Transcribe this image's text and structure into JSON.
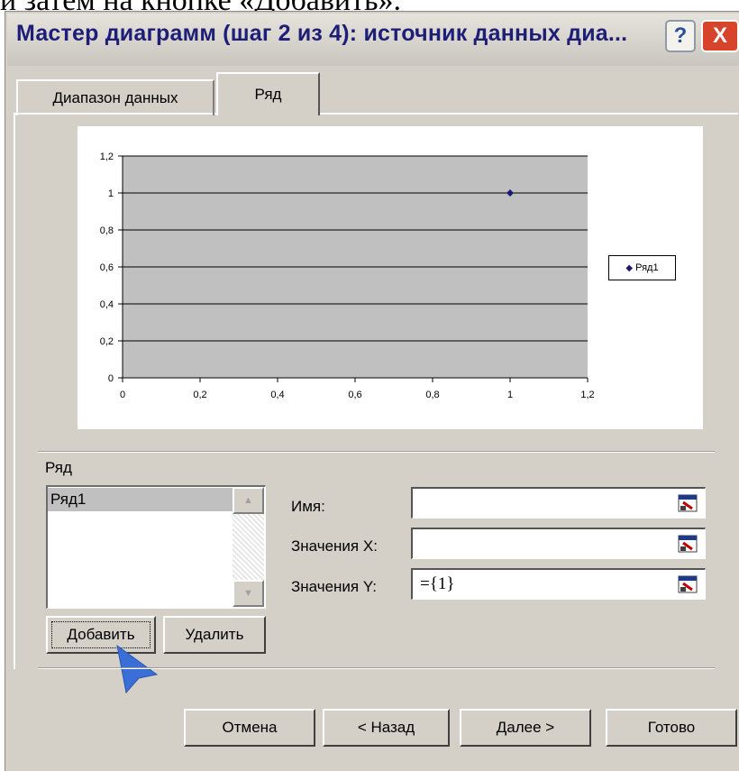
{
  "top_caption": "и затем на кнопке «Добавить».",
  "dialog": {
    "title": "Мастер диаграмм (шаг 2 из 4): источник данных диа...",
    "help_label": "?",
    "close_label": "X"
  },
  "tabs": [
    {
      "label": "Диапазон данных",
      "active": false
    },
    {
      "label": "Ряд",
      "active": true
    }
  ],
  "chart_data": {
    "type": "scatter",
    "series": [
      {
        "name": "Ряд1",
        "x": [
          1
        ],
        "y": [
          1
        ]
      }
    ],
    "xlim": [
      0,
      1.2
    ],
    "ylim": [
      0,
      1.2
    ],
    "x_ticks": [
      "0",
      "0,2",
      "0,4",
      "0,6",
      "0,8",
      "1",
      "1,2"
    ],
    "y_ticks": [
      "0",
      "0,2",
      "0,4",
      "0,6",
      "0,8",
      "1",
      "1,2"
    ],
    "grid": "horizontal",
    "legend": "right",
    "legend_label": "Ряд1",
    "plot_bg": "#c0c0c0",
    "marker_color": "#1a1a6e"
  },
  "series_section": {
    "label": "Ряд",
    "items": [
      "Ряд1"
    ],
    "selected": "Ряд1",
    "add_label": "Добавить",
    "remove_label": "Удалить"
  },
  "fields": {
    "name_label": "Имя:",
    "name_value": "",
    "x_label": "Значения X:",
    "x_value": "",
    "y_label": "Значения Y:",
    "y_value": "={1}"
  },
  "footer": {
    "cancel_label": "Отмена",
    "back_label": "< Назад",
    "next_label": "Далее >",
    "finish_label": "Готово"
  },
  "colors": {
    "dialog_bg": "#d4d0c8",
    "title_text": "#1e1e78",
    "close_button": "#d8432b",
    "cursor": "#3a6fd8"
  },
  "icons": [
    "help-icon",
    "close-icon",
    "range-select-icon",
    "scroll-up-icon",
    "scroll-down-icon",
    "mouse-pointer-icon"
  ]
}
